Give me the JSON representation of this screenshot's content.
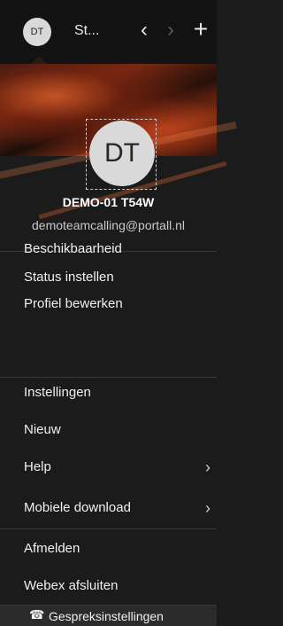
{
  "topbar": {
    "avatar_initials": "DT",
    "tab_title": "St...",
    "back_icon": "chevron-left-icon",
    "forward_icon": "chevron-right-icon",
    "new_icon": "plus-icon"
  },
  "profile": {
    "initials": "DT",
    "name": "DEMO-01 T54W",
    "email": "demoteamcalling@portall.nl"
  },
  "menu": {
    "availability": "Beschikbaarheid",
    "set_status": "Status instellen",
    "edit_profile": "Profiel bewerken",
    "settings": "Instellingen",
    "new": "Nieuw",
    "help": "Help",
    "mobile_download": "Mobiele download",
    "sign_out": "Afmelden",
    "quit": "Webex afsluiten"
  },
  "footer": {
    "call_settings": "Gespreksinstellingen"
  }
}
